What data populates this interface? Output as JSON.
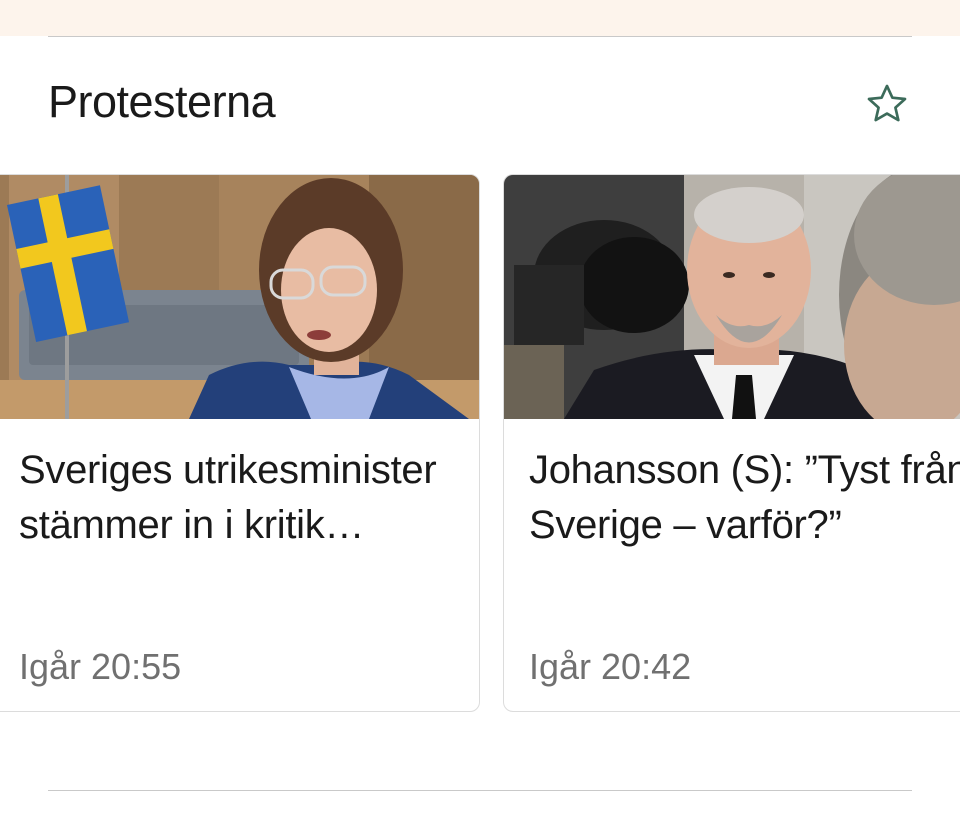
{
  "section": {
    "title": "Protesterna",
    "favorite_icon": "star-outline-icon",
    "accent_color": "#3c6b5a"
  },
  "articles": [
    {
      "title": "Sveriges utrikesminister stämmer in i kritik…",
      "time": "Igår 20:55",
      "image": "politician-at-podium-with-swedish-flag"
    },
    {
      "title": "Johansson (S): ”Tyst från Sverige – varför?”",
      "time": "Igår 20:42",
      "image": "man-interviewed-in-front-of-camera"
    }
  ]
}
